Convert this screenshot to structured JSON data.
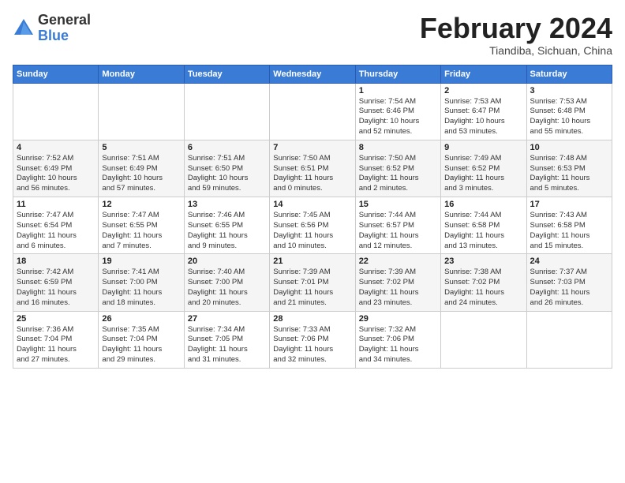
{
  "logo": {
    "general": "General",
    "blue": "Blue"
  },
  "title": "February 2024",
  "location": "Tiandiba, Sichuan, China",
  "days_of_week": [
    "Sunday",
    "Monday",
    "Tuesday",
    "Wednesday",
    "Thursday",
    "Friday",
    "Saturday"
  ],
  "weeks": [
    [
      {
        "day": "",
        "info": ""
      },
      {
        "day": "",
        "info": ""
      },
      {
        "day": "",
        "info": ""
      },
      {
        "day": "",
        "info": ""
      },
      {
        "day": "1",
        "info": "Sunrise: 7:54 AM\nSunset: 6:46 PM\nDaylight: 10 hours\nand 52 minutes."
      },
      {
        "day": "2",
        "info": "Sunrise: 7:53 AM\nSunset: 6:47 PM\nDaylight: 10 hours\nand 53 minutes."
      },
      {
        "day": "3",
        "info": "Sunrise: 7:53 AM\nSunset: 6:48 PM\nDaylight: 10 hours\nand 55 minutes."
      }
    ],
    [
      {
        "day": "4",
        "info": "Sunrise: 7:52 AM\nSunset: 6:49 PM\nDaylight: 10 hours\nand 56 minutes."
      },
      {
        "day": "5",
        "info": "Sunrise: 7:51 AM\nSunset: 6:49 PM\nDaylight: 10 hours\nand 57 minutes."
      },
      {
        "day": "6",
        "info": "Sunrise: 7:51 AM\nSunset: 6:50 PM\nDaylight: 10 hours\nand 59 minutes."
      },
      {
        "day": "7",
        "info": "Sunrise: 7:50 AM\nSunset: 6:51 PM\nDaylight: 11 hours\nand 0 minutes."
      },
      {
        "day": "8",
        "info": "Sunrise: 7:50 AM\nSunset: 6:52 PM\nDaylight: 11 hours\nand 2 minutes."
      },
      {
        "day": "9",
        "info": "Sunrise: 7:49 AM\nSunset: 6:52 PM\nDaylight: 11 hours\nand 3 minutes."
      },
      {
        "day": "10",
        "info": "Sunrise: 7:48 AM\nSunset: 6:53 PM\nDaylight: 11 hours\nand 5 minutes."
      }
    ],
    [
      {
        "day": "11",
        "info": "Sunrise: 7:47 AM\nSunset: 6:54 PM\nDaylight: 11 hours\nand 6 minutes."
      },
      {
        "day": "12",
        "info": "Sunrise: 7:47 AM\nSunset: 6:55 PM\nDaylight: 11 hours\nand 7 minutes."
      },
      {
        "day": "13",
        "info": "Sunrise: 7:46 AM\nSunset: 6:55 PM\nDaylight: 11 hours\nand 9 minutes."
      },
      {
        "day": "14",
        "info": "Sunrise: 7:45 AM\nSunset: 6:56 PM\nDaylight: 11 hours\nand 10 minutes."
      },
      {
        "day": "15",
        "info": "Sunrise: 7:44 AM\nSunset: 6:57 PM\nDaylight: 11 hours\nand 12 minutes."
      },
      {
        "day": "16",
        "info": "Sunrise: 7:44 AM\nSunset: 6:58 PM\nDaylight: 11 hours\nand 13 minutes."
      },
      {
        "day": "17",
        "info": "Sunrise: 7:43 AM\nSunset: 6:58 PM\nDaylight: 11 hours\nand 15 minutes."
      }
    ],
    [
      {
        "day": "18",
        "info": "Sunrise: 7:42 AM\nSunset: 6:59 PM\nDaylight: 11 hours\nand 16 minutes."
      },
      {
        "day": "19",
        "info": "Sunrise: 7:41 AM\nSunset: 7:00 PM\nDaylight: 11 hours\nand 18 minutes."
      },
      {
        "day": "20",
        "info": "Sunrise: 7:40 AM\nSunset: 7:00 PM\nDaylight: 11 hours\nand 20 minutes."
      },
      {
        "day": "21",
        "info": "Sunrise: 7:39 AM\nSunset: 7:01 PM\nDaylight: 11 hours\nand 21 minutes."
      },
      {
        "day": "22",
        "info": "Sunrise: 7:39 AM\nSunset: 7:02 PM\nDaylight: 11 hours\nand 23 minutes."
      },
      {
        "day": "23",
        "info": "Sunrise: 7:38 AM\nSunset: 7:02 PM\nDaylight: 11 hours\nand 24 minutes."
      },
      {
        "day": "24",
        "info": "Sunrise: 7:37 AM\nSunset: 7:03 PM\nDaylight: 11 hours\nand 26 minutes."
      }
    ],
    [
      {
        "day": "25",
        "info": "Sunrise: 7:36 AM\nSunset: 7:04 PM\nDaylight: 11 hours\nand 27 minutes."
      },
      {
        "day": "26",
        "info": "Sunrise: 7:35 AM\nSunset: 7:04 PM\nDaylight: 11 hours\nand 29 minutes."
      },
      {
        "day": "27",
        "info": "Sunrise: 7:34 AM\nSunset: 7:05 PM\nDaylight: 11 hours\nand 31 minutes."
      },
      {
        "day": "28",
        "info": "Sunrise: 7:33 AM\nSunset: 7:06 PM\nDaylight: 11 hours\nand 32 minutes."
      },
      {
        "day": "29",
        "info": "Sunrise: 7:32 AM\nSunset: 7:06 PM\nDaylight: 11 hours\nand 34 minutes."
      },
      {
        "day": "",
        "info": ""
      },
      {
        "day": "",
        "info": ""
      }
    ]
  ]
}
